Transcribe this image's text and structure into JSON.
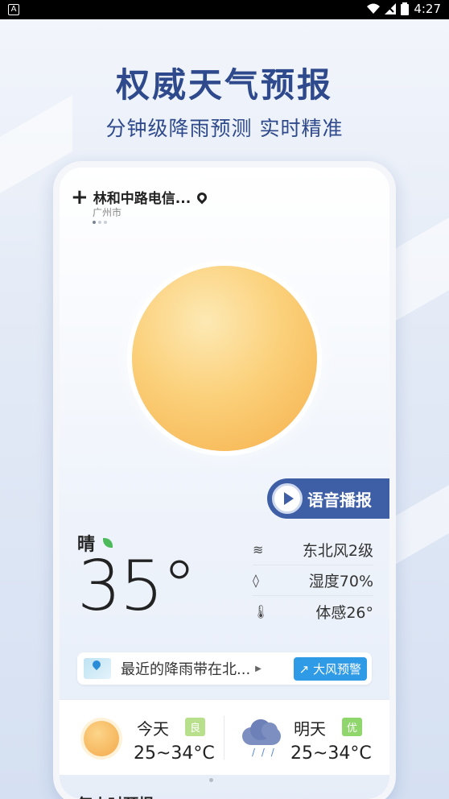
{
  "status_bar": {
    "time": "4:27",
    "app_badge": "A"
  },
  "headline": "权威天气预报",
  "subline": "分钟级降雨预测 实时精准",
  "location": {
    "name": "林和中路电信...",
    "city": "广州市"
  },
  "current": {
    "condition": "晴",
    "temperature": "35°",
    "voice_label": "语音播报",
    "wind": "东北风2级",
    "humidity": "湿度70%",
    "feels_like": "体感26°"
  },
  "alert": {
    "text": "最近的降雨带在北...",
    "warning_label": "大风预警"
  },
  "forecast": [
    {
      "day": "今天",
      "aqi": "良",
      "range": "25~34°C",
      "icon": "sunny-icon"
    },
    {
      "day": "明天",
      "aqi": "优",
      "range": "25~34°C",
      "icon": "rain-cloud-icon"
    }
  ],
  "hourly_title": "每小时预报",
  "colors": {
    "brand": "#2f4a8c",
    "voice_button": "#3e5fa6",
    "warning": "#2f9be6"
  }
}
